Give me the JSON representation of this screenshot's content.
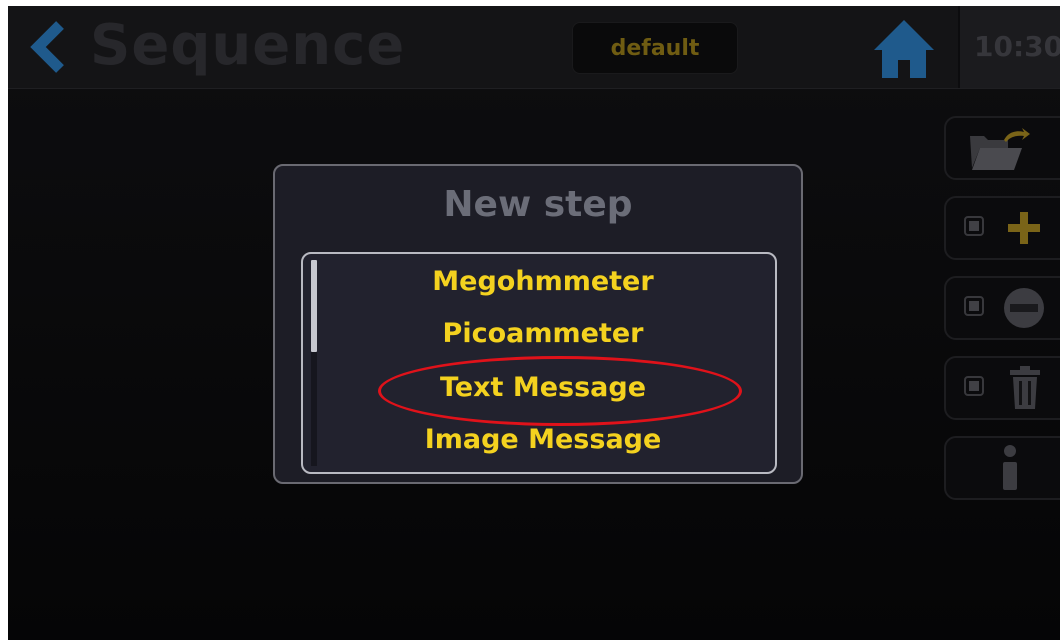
{
  "header": {
    "title": "Sequence",
    "profile": "default",
    "clock": "10:30"
  },
  "dialog": {
    "title": "New step",
    "items": [
      {
        "label": "Megohmmeter"
      },
      {
        "label": "Picoammeter"
      },
      {
        "label": "Text Message"
      },
      {
        "label": "Image Message"
      }
    ],
    "highlighted_item": "Text Message"
  },
  "sidebar": {
    "buttons": [
      "open-folder",
      "add-step",
      "remove-step",
      "delete-step",
      "info"
    ]
  },
  "colors": {
    "accent_yellow": "#f4d21f",
    "back_arrow_blue": "#1f5a8c",
    "home_blue": "#1f5a8c",
    "highlight_red": "#e0121a"
  },
  "icons": {
    "back": "chevron-left-icon",
    "home": "home-icon",
    "folder": "folder-open-icon",
    "add": "plus-icon",
    "remove": "minus-circle-icon",
    "delete": "trash-icon",
    "info": "info-icon"
  }
}
